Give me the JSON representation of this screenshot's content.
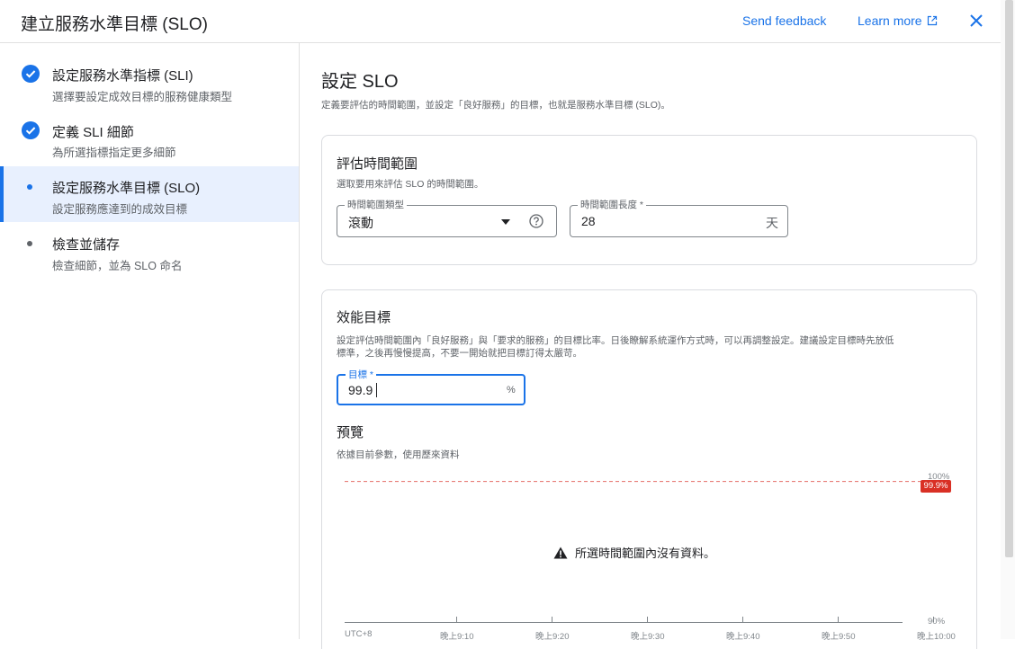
{
  "header": {
    "title": "建立服務水準目標 (SLO)",
    "send_feedback": "Send feedback",
    "learn_more": "Learn more"
  },
  "steps": [
    {
      "title": "設定服務水準指標 (SLI)",
      "subtitle": "選擇要設定成效目標的服務健康類型",
      "state": "done"
    },
    {
      "title": "定義 SLI 細節",
      "subtitle": "為所選指標指定更多細節",
      "state": "done"
    },
    {
      "title": "設定服務水準目標 (SLO)",
      "subtitle": "設定服務應達到的成效目標",
      "state": "active"
    },
    {
      "title": "檢查並儲存",
      "subtitle": "檢查細節，並為 SLO 命名",
      "state": "pending"
    }
  ],
  "main": {
    "title": "設定 SLO",
    "description": "定義要評估的時間範圍，並設定「良好服務」的目標，也就是服務水準目標 (SLO)。"
  },
  "period_card": {
    "title": "評估時間範圍",
    "description": "選取要用來評估 SLO 的時間範圍。",
    "type_field": {
      "label": "時間範圍類型",
      "value": "滾動"
    },
    "length_field": {
      "label": "時間範圍長度 *",
      "value": "28",
      "suffix": "天"
    }
  },
  "goal_card": {
    "title": "效能目標",
    "description_line1": "設定評估時間範圍內「良好服務」與「要求的服務」的目標比率。日後瞭解系統運作方式時，可以再調整設定。建議設定目標時先放低",
    "description_line2": "標準，之後再慢慢提高，不要一開始就把目標訂得太嚴苛。",
    "goal_field": {
      "label": "目標 *",
      "value": "99.9",
      "suffix": "%"
    },
    "preview_title": "預覽",
    "preview_desc": "依據目前參數，使用歷來資料"
  },
  "chart_data": {
    "type": "line",
    "series": [],
    "y_labels": [
      "100%",
      "90%"
    ],
    "ylim": [
      90,
      100
    ],
    "threshold": {
      "value": 99.9,
      "label": "99.9%",
      "color": "#d93025"
    },
    "x_ticks": [
      "UTC+8",
      "晚上9:10",
      "晚上9:20",
      "晚上9:30",
      "晚上9:40",
      "晚上9:50",
      "晚上10:00"
    ],
    "no_data_message": "所選時間範圍內沒有資料。"
  },
  "colors": {
    "accent": "#1a73e8",
    "threshold": "#d93025"
  }
}
